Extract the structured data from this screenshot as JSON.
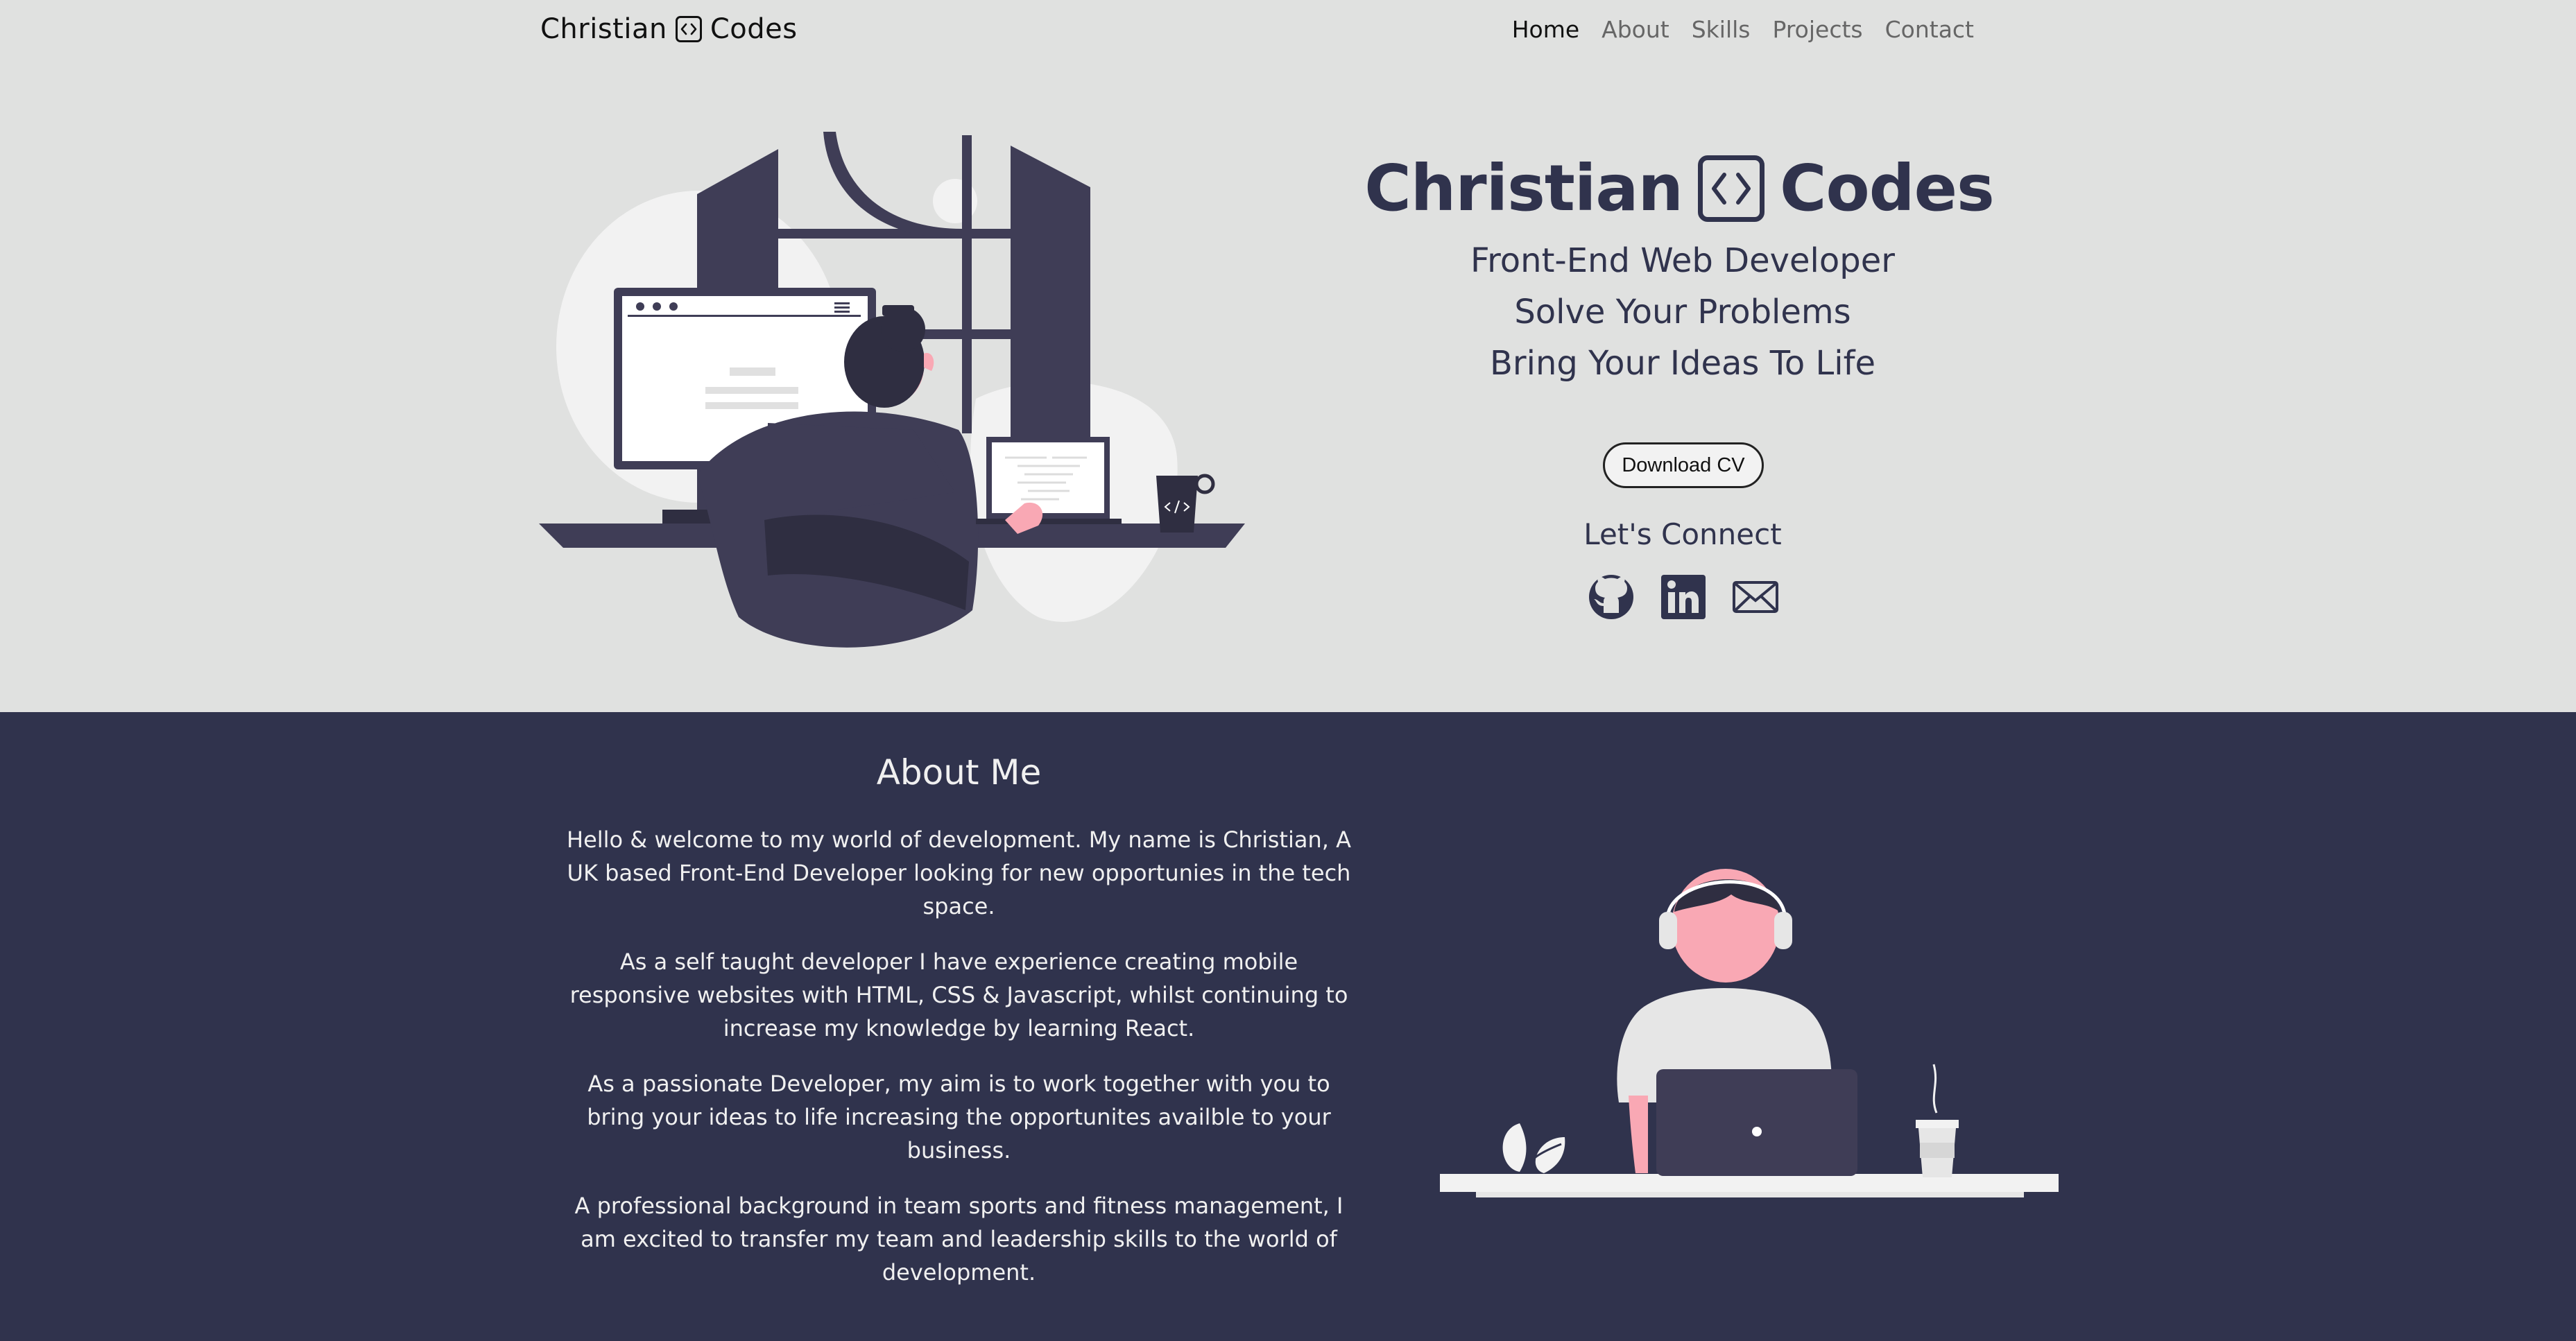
{
  "nav": {
    "brand_first": "Christian",
    "brand_second": "Codes",
    "items": [
      {
        "label": "Home",
        "active": true
      },
      {
        "label": "About",
        "active": false
      },
      {
        "label": "Skills",
        "active": false
      },
      {
        "label": "Projects",
        "active": false
      },
      {
        "label": "Contact",
        "active": false
      }
    ]
  },
  "hero": {
    "title_first": "Christian",
    "title_second": "Codes",
    "lines": [
      "Front-End Web Developer",
      "Solve Your Problems",
      "Bring Your Ideas To Life"
    ],
    "cv_button": "Download CV",
    "connect_label": "Let's Connect",
    "socials": [
      {
        "icon": "github-icon"
      },
      {
        "icon": "linkedin-icon"
      },
      {
        "icon": "mail-icon"
      }
    ]
  },
  "about": {
    "title": "About Me",
    "paragraphs": [
      "Hello & welcome to my world of development. My name is Christian, A UK based Front-End Developer looking for new opportunies in the tech space.",
      "As a self taught developer I have experience creating mobile responsive websites with HTML, CSS & Javascript, whilst continuing to increase my knowledge by learning React.",
      "As a passionate Developer, my aim is to work together with you to bring your ideas to life increasing the opportunites availble to your business.",
      "A professional background in team sports and fitness management, I am excited to transfer my team and leadership skills to the world of development."
    ]
  },
  "colors": {
    "hero_bg": "#e0e1e0",
    "navy": "#30334d",
    "accent_pink": "#f9a8b4",
    "light_text": "#f0f0f0"
  }
}
